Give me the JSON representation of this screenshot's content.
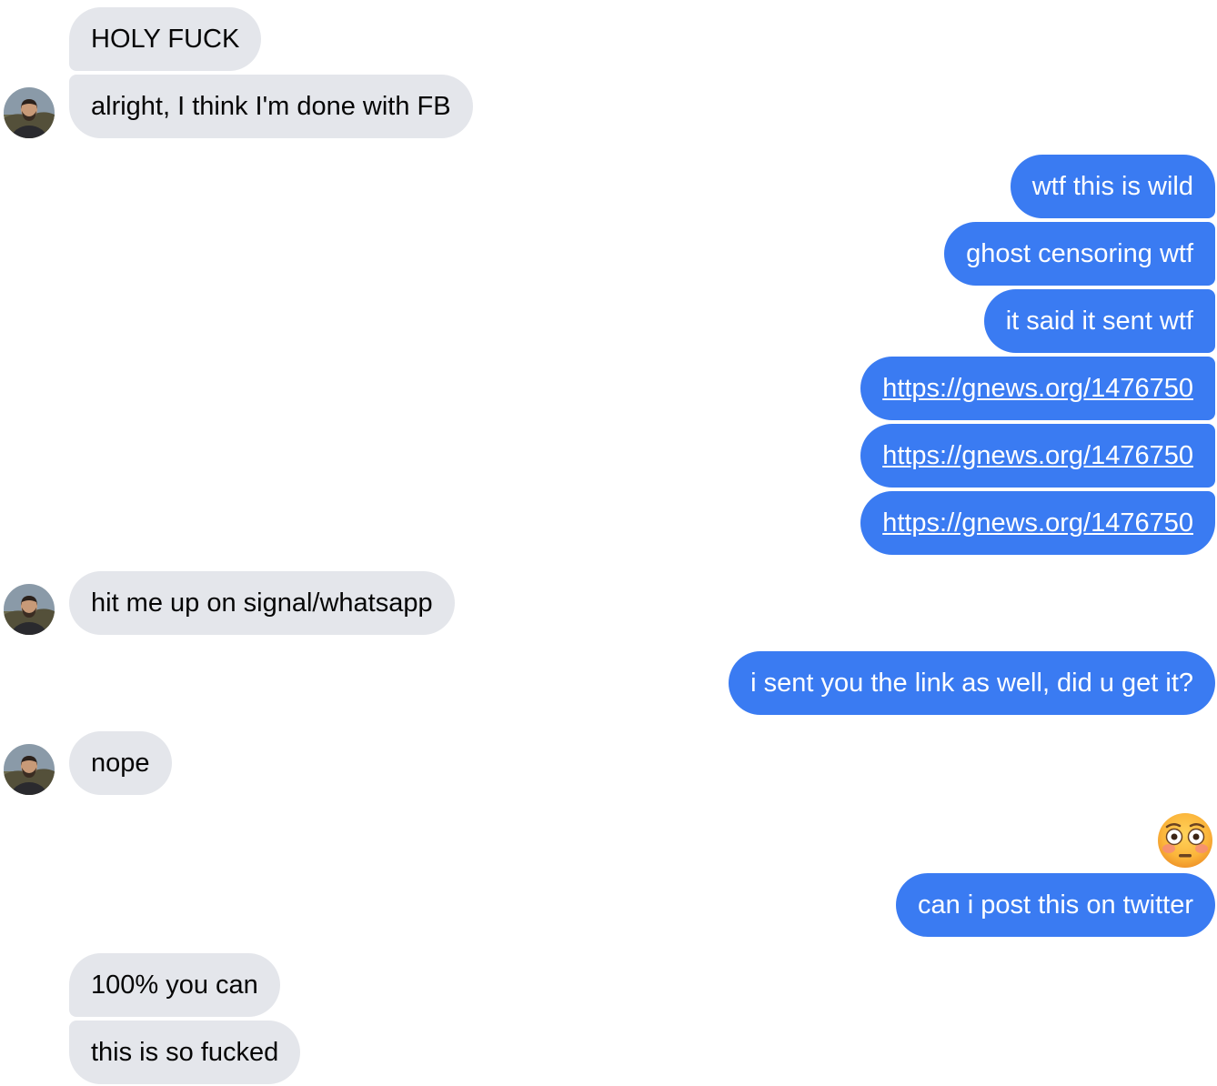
{
  "messages": [
    {
      "from": "them",
      "text": "HOLY FUCK"
    },
    {
      "from": "them",
      "text": "alright, I think I'm done with FB"
    },
    {
      "from": "me",
      "text": "wtf this is wild"
    },
    {
      "from": "me",
      "text": "ghost censoring wtf"
    },
    {
      "from": "me",
      "text": "it said it sent wtf"
    },
    {
      "from": "me",
      "text": "https://gnews.org/1476750",
      "link": true
    },
    {
      "from": "me",
      "text": "https://gnews.org/1476750",
      "link": true
    },
    {
      "from": "me",
      "text": "https://gnews.org/1476750",
      "link": true
    },
    {
      "from": "them",
      "text": "hit me up on signal/whatsapp"
    },
    {
      "from": "me",
      "text": "i sent you the link as well, did u get it?"
    },
    {
      "from": "them",
      "text": "nope"
    },
    {
      "from": "me",
      "emoji": "flushed-face"
    },
    {
      "from": "me",
      "text": "can i post this on twitter"
    },
    {
      "from": "them",
      "text": "100% you can"
    },
    {
      "from": "them",
      "text": "this is so fucked"
    }
  ],
  "colors": {
    "incoming_bubble": "#e4e6eb",
    "outgoing_bubble": "#3a7bf2"
  }
}
